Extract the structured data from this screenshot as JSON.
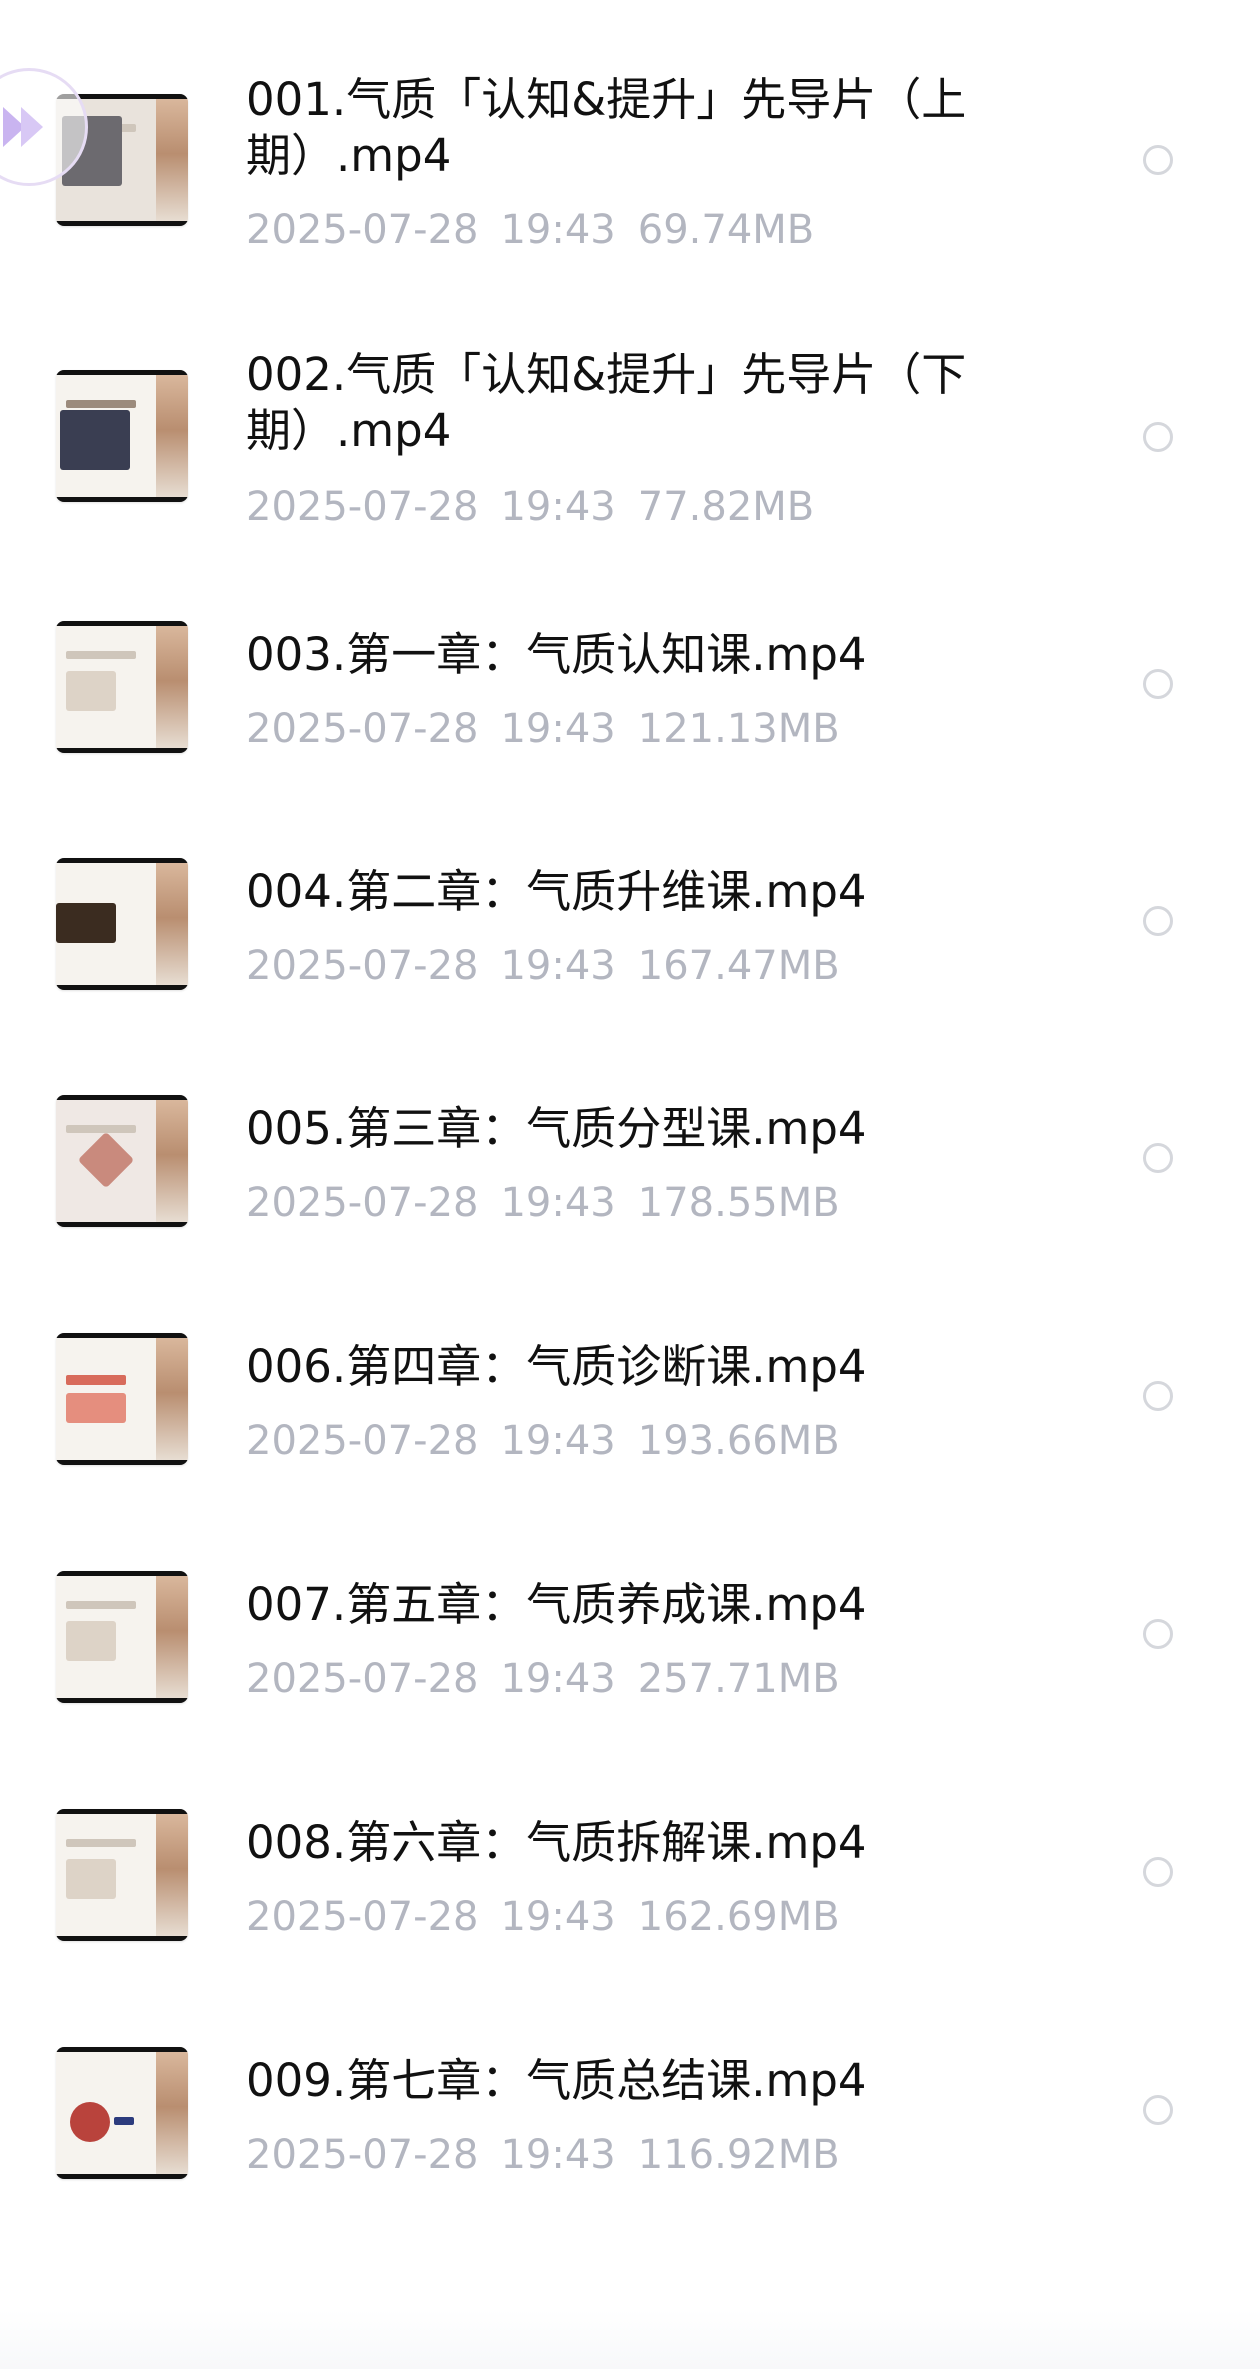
{
  "files": [
    {
      "name": "001.气质「认知&提升」先导片（上期）.mp4",
      "date": "2025-07-28",
      "time": "19:43",
      "size": "69.74MB"
    },
    {
      "name": "002.气质「认知&提升」先导片（下期）.mp4",
      "date": "2025-07-28",
      "time": "19:43",
      "size": "77.82MB"
    },
    {
      "name": "003.第一章：气质认知课.mp4",
      "date": "2025-07-28",
      "time": "19:43",
      "size": "121.13MB"
    },
    {
      "name": "004.第二章：气质升维课.mp4",
      "date": "2025-07-28",
      "time": "19:43",
      "size": "167.47MB"
    },
    {
      "name": "005.第三章：气质分型课.mp4",
      "date": "2025-07-28",
      "time": "19:43",
      "size": "178.55MB"
    },
    {
      "name": "006.第四章：气质诊断课.mp4",
      "date": "2025-07-28",
      "time": "19:43",
      "size": "193.66MB"
    },
    {
      "name": "007.第五章：气质养成课.mp4",
      "date": "2025-07-28",
      "time": "19:43",
      "size": "257.71MB"
    },
    {
      "name": "008.第六章：气质拆解课.mp4",
      "date": "2025-07-28",
      "time": "19:43",
      "size": "162.69MB"
    },
    {
      "name": "009.第七章：气质总结课.mp4",
      "date": "2025-07-28",
      "time": "19:43",
      "size": "116.92MB"
    }
  ],
  "icons": {
    "thumbnail": "video-thumbnail",
    "select": "radio-circle-icon",
    "floating": "floating-assistant-icon"
  },
  "colors": {
    "title": "#111111",
    "meta": "#b3b6c0",
    "radio_border": "#d5d7dc",
    "assistant_accent": "#c9b4f0"
  }
}
